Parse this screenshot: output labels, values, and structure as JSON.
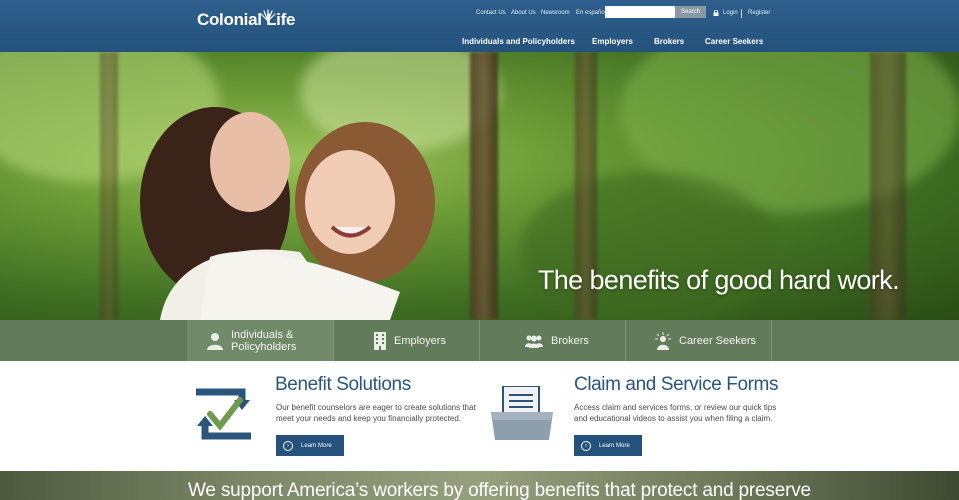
{
  "header": {
    "logo_text": "Colonial Life",
    "utility_links": [
      "Contact Us",
      "About Us",
      "Newsroom",
      "En español"
    ],
    "search": {
      "placeholder": "",
      "button_label": "Search"
    },
    "login_label": "Login",
    "register_label": "Register",
    "main_nav": [
      "Individuals and Policyholders",
      "Employers",
      "Brokers",
      "Career Seekers"
    ]
  },
  "hero": {
    "headline": "The benefits of good hard work."
  },
  "audience_bar": {
    "tabs": [
      {
        "label_line1": "Individuals &",
        "label_line2": "Policyholders",
        "icon": "person-icon"
      },
      {
        "label": "Employers",
        "icon": "building-icon"
      },
      {
        "label": "Brokers",
        "icon": "group-icon"
      },
      {
        "label": "Career Seekers",
        "icon": "lightbulb-person-icon"
      }
    ]
  },
  "features": [
    {
      "title": "Benefit Solutions",
      "text_line1": "Our benefit counselors are eager to create solutions that",
      "text_line2": "meet your needs and keep you financially protected.",
      "button_label": "Learn More",
      "icon": "checkmark-refresh-icon"
    },
    {
      "title": "Claim and Service Forms",
      "text_line1": "Access claim and services forms, or review our quick tips",
      "text_line2": "and educational videos to assist you when filing a claim.",
      "button_label": "Learn More",
      "icon": "folder-document-icon"
    }
  ],
  "banner": {
    "text": "We support America’s workers by offering benefits that protect and preserve"
  },
  "colors": {
    "header_blue": "#24527c",
    "audience_green": "#627b5b",
    "title_blue": "#2c557c",
    "icon_green": "#5b8a4a"
  }
}
